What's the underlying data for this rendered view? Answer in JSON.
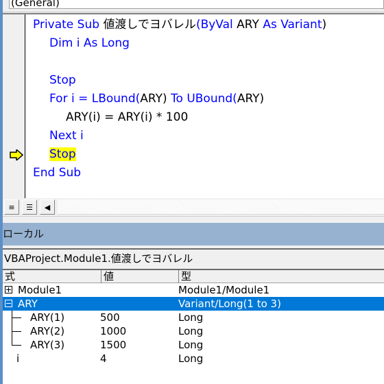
{
  "code_window": {
    "procedure_combo": "(General)",
    "lines": [
      {
        "segments": [
          {
            "t": "Private Sub ",
            "c": "kw"
          },
          {
            "t": "値渡しでヨバレル",
            "c": "plain"
          },
          {
            "t": "(ByVal ",
            "c": "kw"
          },
          {
            "t": "ARY ",
            "c": "plain"
          },
          {
            "t": "As Variant",
            "c": "kw"
          },
          {
            "t": ")",
            "c": "plain"
          }
        ],
        "indent": 0
      },
      {
        "segments": [
          {
            "t": "Dim i As Long",
            "c": "kw"
          }
        ],
        "indent": 1
      },
      {
        "segments": [
          {
            "t": "",
            "c": "plain"
          }
        ],
        "indent": 1
      },
      {
        "segments": [
          {
            "t": "Stop",
            "c": "kw"
          }
        ],
        "indent": 1
      },
      {
        "segments": [
          {
            "t": "For i = LBound(",
            "c": "kw"
          },
          {
            "t": "ARY)",
            "c": "plain"
          },
          {
            "t": " To UBound(",
            "c": "kw"
          },
          {
            "t": "ARY)",
            "c": "plain"
          }
        ],
        "indent": 1
      },
      {
        "segments": [
          {
            "t": "ARY(i) = ARY(i) * 100",
            "c": "plain"
          }
        ],
        "indent": 2
      },
      {
        "segments": [
          {
            "t": "Next i",
            "c": "kw"
          }
        ],
        "indent": 1
      },
      {
        "segments": [
          {
            "t": "Stop",
            "c": "kw hl"
          }
        ],
        "indent": 1,
        "current": true
      },
      {
        "segments": [
          {
            "t": "End Sub",
            "c": "kw"
          }
        ],
        "indent": 0
      }
    ],
    "execution_pointer_icon": "yellow-arrow",
    "view_buttons": [
      "procedure-view",
      "full-module-view"
    ],
    "scroll_left_icon": "left-triangle"
  },
  "locals": {
    "title": "ローカル",
    "context": "VBAProject.Module1.値渡しでヨバレル",
    "columns": [
      "式",
      "値",
      "型"
    ],
    "rows": [
      {
        "expr": "Module1",
        "value": "",
        "type": "Module1/Module1",
        "expander": "plus",
        "selected": false
      },
      {
        "expr": "ARY",
        "value": "",
        "type": "Variant/Long(1 to 3)",
        "expander": "minus",
        "selected": true
      },
      {
        "expr": "ARY(1)",
        "value": "500",
        "type": "Long",
        "child": true
      },
      {
        "expr": "ARY(2)",
        "value": "1000",
        "type": "Long",
        "child": true
      },
      {
        "expr": "ARY(3)",
        "value": "1500",
        "type": "Long",
        "child": true,
        "last": true
      },
      {
        "expr": "i",
        "value": "4",
        "type": "Long"
      }
    ]
  },
  "colors": {
    "keyword": "#0000ff",
    "highlight": "#ffff00",
    "selection": "#0078d7",
    "locals_title_bg": "#97b2d1"
  }
}
